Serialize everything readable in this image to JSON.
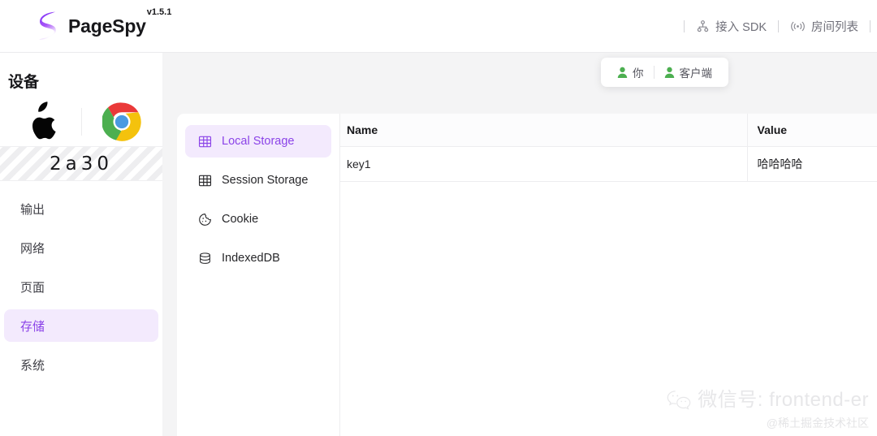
{
  "app": {
    "brand_name": "PageSpy",
    "version": "v1.5.1"
  },
  "topnav": {
    "items": [
      {
        "label": "接入 SDK",
        "icon": "deployment-unit-icon"
      },
      {
        "label": "房间列表",
        "icon": "broadcast-icon"
      }
    ]
  },
  "sidebar": {
    "title": "设备",
    "device": {
      "os_icon": "apple-logo-icon",
      "browser_icon": "chrome-logo-icon",
      "id": "2a30"
    },
    "items": [
      {
        "label": "输出",
        "active": false
      },
      {
        "label": "网络",
        "active": false
      },
      {
        "label": "页面",
        "active": false
      },
      {
        "label": "存储",
        "active": true
      },
      {
        "label": "系统",
        "active": false
      }
    ]
  },
  "members": {
    "items": [
      {
        "label": "你",
        "icon": "user-icon"
      },
      {
        "label": "客户端",
        "icon": "user-icon"
      }
    ],
    "icon_color": "#4caf50"
  },
  "storage": {
    "subnav": [
      {
        "label": "Local Storage",
        "icon": "table-icon",
        "active": true
      },
      {
        "label": "Session Storage",
        "icon": "table-icon",
        "active": false
      },
      {
        "label": "Cookie",
        "icon": "cookie-icon",
        "active": false
      },
      {
        "label": "IndexedDB",
        "icon": "database-icon",
        "active": false
      }
    ],
    "table": {
      "columns": [
        "Name",
        "Value"
      ],
      "rows": [
        {
          "name": "key1",
          "value": "哈哈哈哈"
        }
      ]
    }
  },
  "watermark": {
    "icon": "wechat-icon",
    "line1": "微信号: frontend-er",
    "line2": "@稀土掘金技术社区"
  },
  "colors": {
    "accent": "#8b43e8",
    "accent_bg": "#f3eafd",
    "canvas": "#f4f4f5"
  }
}
